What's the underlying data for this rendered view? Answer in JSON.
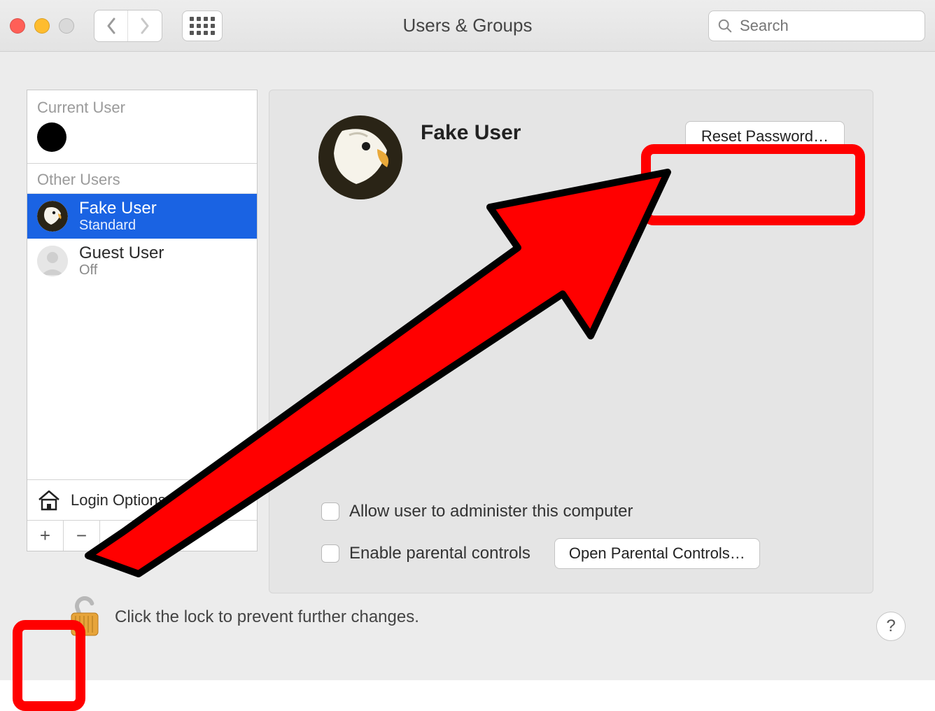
{
  "window": {
    "title": "Users & Groups",
    "search_placeholder": "Search"
  },
  "sidebar": {
    "current_label": "Current User",
    "other_label": "Other Users",
    "users": [
      {
        "name": "Fake User",
        "role": "Standard",
        "selected": true
      },
      {
        "name": "Guest User",
        "role": "Off",
        "selected": false
      }
    ],
    "login_options": "Login Options"
  },
  "detail": {
    "name": "Fake User",
    "reset_button": "Reset Password…",
    "admin_checkbox": "Allow user to administer this computer",
    "parental_checkbox": "Enable parental controls",
    "parental_button": "Open Parental Controls…"
  },
  "footer": {
    "lock_text": "Click the lock to prevent further changes.",
    "help": "?"
  },
  "colors": {
    "selection": "#1a63e3",
    "annotation": "#ff0000"
  }
}
